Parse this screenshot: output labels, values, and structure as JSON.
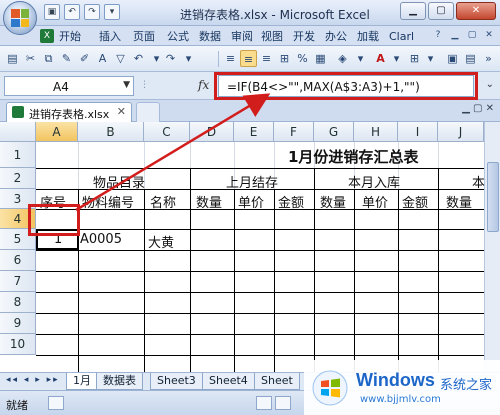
{
  "window": {
    "title": "进销存表格.xlsx - Microsoft Excel",
    "minimize_icon": "minimize-icon",
    "restore_icon": "restore-icon",
    "close_icon": "close-icon"
  },
  "ribbon_tabs": [
    {
      "label": "开始"
    },
    {
      "label": "插入"
    },
    {
      "label": "页面"
    },
    {
      "label": "公式"
    },
    {
      "label": "数据"
    },
    {
      "label": "审阅"
    },
    {
      "label": "视图"
    },
    {
      "label": "开发"
    },
    {
      "label": "办公"
    },
    {
      "label": "加载"
    },
    {
      "label": "Clarl"
    }
  ],
  "formula_bar": {
    "name_box": "A4",
    "fx_label": "fx",
    "formula": "=IF(B4<>\"\",MAX(A$3:A3)+1,\"\")"
  },
  "document_tab": {
    "filename": "进销存表格.xlsx"
  },
  "columns": [
    "A",
    "B",
    "C",
    "D",
    "E",
    "F",
    "G",
    "H",
    "I",
    "J"
  ],
  "rows": [
    "1",
    "2",
    "3",
    "4",
    "5",
    "6",
    "7",
    "8",
    "9",
    "10"
  ],
  "sheet": {
    "title": "1月份进销存汇总表",
    "group_headers": {
      "materials": "物品目录",
      "last_month": "上月结存",
      "this_month_in": "本月入库",
      "partial": "本"
    },
    "subheaders": {
      "serial": "序号",
      "code": "物料编号",
      "name": "名称",
      "qty1": "数量",
      "price1": "单价",
      "amount1": "金额",
      "qty2": "数量",
      "price2": "单价",
      "amount2": "金额",
      "qty3": "数量"
    },
    "row4": {
      "serial": "1",
      "code": "A0005",
      "name": "大黄"
    }
  },
  "sheet_tabs": [
    {
      "label": "1月"
    },
    {
      "label": "数据表"
    },
    {
      "label": "Sheet3"
    },
    {
      "label": "Sheet4"
    },
    {
      "label": "Sheet"
    }
  ],
  "status": {
    "ready": "就绪"
  },
  "watermark": {
    "brand": "Windows",
    "cn": "系统之家",
    "url": "www.bjjmlv.com"
  },
  "colors": {
    "annotation_red": "#d21d1d",
    "selection_header": "#f2c45f"
  }
}
